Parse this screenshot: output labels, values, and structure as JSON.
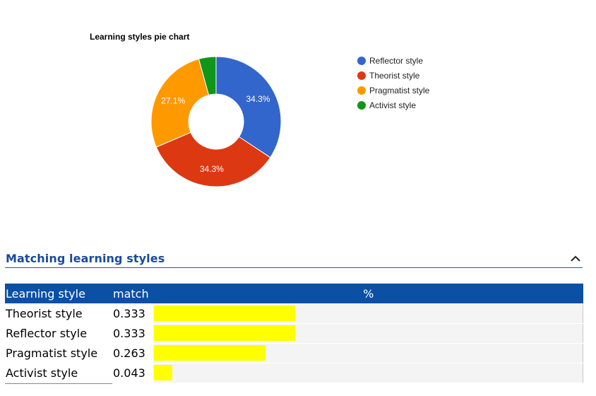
{
  "chart_data": {
    "type": "pie",
    "title": "Learning styles pie chart",
    "donut": true,
    "legend_position": "right",
    "slices": [
      {
        "name": "Reflector style",
        "value": 34.3,
        "label": "34.3%",
        "color": "#3366cc"
      },
      {
        "name": "Theorist style",
        "value": 34.3,
        "label": "34.3%",
        "color": "#dc3912"
      },
      {
        "name": "Pragmatist style",
        "value": 27.1,
        "label": "27.1%",
        "color": "#ff9900"
      },
      {
        "name": "Activist style",
        "value": 4.3,
        "label": "",
        "color": "#109618"
      }
    ]
  },
  "section": {
    "title": "Matching learning styles",
    "collapse_icon": "chevron-up-icon"
  },
  "table": {
    "headers": {
      "style": "Learning style",
      "match": "match",
      "pct": "%"
    },
    "rows": [
      {
        "style": "Theorist style",
        "match": "0.333",
        "fraction": 0.333
      },
      {
        "style": "Reflector style",
        "match": "0.333",
        "fraction": 0.333
      },
      {
        "style": "Pragmatist style",
        "match": "0.263",
        "fraction": 0.263
      },
      {
        "style": "Activist style",
        "match": "0.043",
        "fraction": 0.043
      }
    ],
    "bar_color": "#ffff00",
    "header_color": "#0b50a5"
  }
}
